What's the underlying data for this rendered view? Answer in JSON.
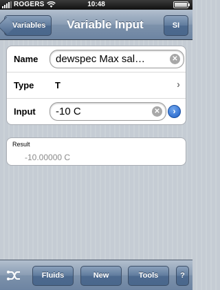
{
  "status_bar": {
    "carrier": "ROGERS",
    "time": "10:48"
  },
  "nav": {
    "back_label": "Variables",
    "title": "Variable Input",
    "units_label": "SI"
  },
  "form": {
    "name_label": "Name",
    "name_value": "dewspec Max sal…",
    "type_label": "Type",
    "type_value": "T",
    "input_label": "Input",
    "input_value": "-10 C"
  },
  "result": {
    "label": "Result",
    "value": "-10.00000 C"
  },
  "toolbar": {
    "fluids_label": "Fluids",
    "new_label": "New",
    "tools_label": "Tools",
    "help_label": "?"
  },
  "icons": {
    "mix": "mix-icon",
    "clear": "clear-icon",
    "chevron": "chevron-right-icon",
    "go": "go-arrow-icon"
  }
}
